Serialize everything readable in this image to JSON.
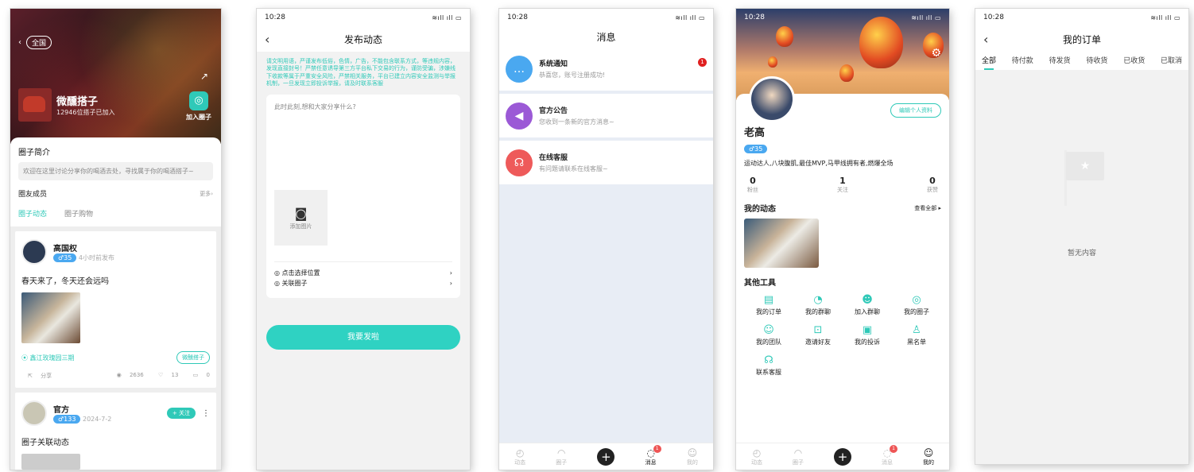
{
  "screen1": {
    "region_chip": "全国",
    "group_name": "微醺搭子",
    "group_sub": "12946位搭子已加入",
    "join_label": "加入圈子",
    "intro_title": "圈子简介",
    "intro_text": "欢迎在这里讨论分享你的喝酒去处，寻找属于你的喝酒搭子~",
    "members_title": "圈友成员",
    "members_more": "更多",
    "tabs": [
      "圈子动态",
      "圈子购物"
    ],
    "post1": {
      "name": "高国权",
      "badge": "♂35",
      "time": "4小时前发布",
      "text": "春天来了，冬天还会远吗",
      "location": "鑫江玫瑰园三期",
      "tag": "微醺搭子",
      "share": "分享",
      "views": "2636",
      "likes": "13",
      "comments": "0"
    },
    "post2": {
      "name": "官方",
      "badge": "♂133",
      "time": "2024-7-2",
      "follow": "+ 关注",
      "text": "圈子关联动态"
    }
  },
  "screen2": {
    "time": "10:28",
    "title": "发布动态",
    "notice": "请文明用语，严谨发布低俗，色情，广告，不能包含联系方式，等违规内容，发现直接封号！严禁任意诱导第三方平台私下交易的行为，谨防受骗，涉嫌线下收款等属于严重安全风险，严禁相关服务，平台已建立内容安全监测与举报机制，一旦发现立即投诉举报，请及时联系客服",
    "placeholder": "此时此刻,想和大家分享什么?",
    "add_photo": "添加图片",
    "location_label": "点击选择位置",
    "circle_label": "关联圈子",
    "submit": "我要发啦"
  },
  "screen3": {
    "time": "10:28",
    "title": "消息",
    "items": [
      {
        "title": "系统通知",
        "sub": "恭喜您，账号注册成功!",
        "badge": "1",
        "color": "#4aa8f0"
      },
      {
        "title": "官方公告",
        "sub": "您收到一条新的官方消息~",
        "color": "#9b59d6"
      },
      {
        "title": "在线客服",
        "sub": "有问题请联系在线客服~",
        "color": "#ee5a5a"
      }
    ],
    "tabbar": [
      "动态",
      "圈子",
      "消息",
      "我的"
    ],
    "msg_badge": "1"
  },
  "screen4": {
    "time": "10:28",
    "edit": "编辑个人资料",
    "name": "老高",
    "badge": "♂35",
    "bio": "运动达人,八块腹肌,最佳MVP,马甲线拥有者,燃爆全场",
    "counts": [
      {
        "n": "0",
        "l": "粉丝"
      },
      {
        "n": "1",
        "l": "关注"
      },
      {
        "n": "0",
        "l": "获赞"
      }
    ],
    "dyn_title": "我的动态",
    "view_all": "查看全部",
    "tools_title": "其他工具",
    "tools": [
      "我的订单",
      "我的群聊",
      "加入群聊",
      "我的圈子",
      "我的团队",
      "邀请好友",
      "我的投诉",
      "黑名单",
      "联系客服"
    ],
    "tabbar": [
      "动态",
      "圈子",
      "消息",
      "我的"
    ],
    "msg_badge": "1"
  },
  "screen5": {
    "time": "10:28",
    "title": "我的订单",
    "tabs": [
      "全部",
      "待付款",
      "待发货",
      "待收货",
      "已收货",
      "已取消"
    ],
    "empty": "暂无内容"
  },
  "colors": {
    "accent": "#2fc9b8",
    "badge_blue": "#4aa8f0",
    "alert_red": "#e02020"
  }
}
